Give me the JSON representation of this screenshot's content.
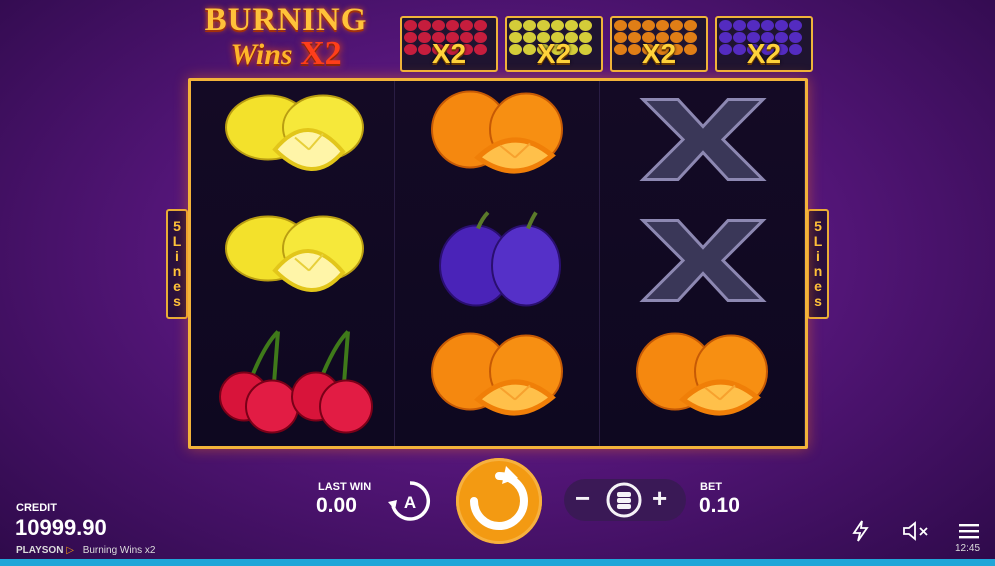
{
  "game": {
    "title_line1": "BURNING",
    "title_line2": "Wins",
    "title_x2": "X2"
  },
  "multipliers": [
    {
      "label": "X2",
      "fruit": "cherry-icon",
      "color": "#d91f3f"
    },
    {
      "label": "X2",
      "fruit": "lemon-icon",
      "color": "#e8e23a"
    },
    {
      "label": "X2",
      "fruit": "orange-icon",
      "color": "#f58a14"
    },
    {
      "label": "X2",
      "fruit": "plum-icon",
      "color": "#5a2ed0"
    }
  ],
  "paylines": {
    "number": "5",
    "letters": [
      "L",
      "i",
      "n",
      "e",
      "s"
    ]
  },
  "reels": [
    [
      "lemon-icon",
      "lemon-icon",
      "cherry-icon"
    ],
    [
      "orange-icon",
      "plum-icon",
      "orange-icon"
    ],
    [
      "x-symbol-icon",
      "x-symbol-icon",
      "orange-icon"
    ]
  ],
  "controls": {
    "last_win_label": "LAST WIN",
    "last_win": "0.00",
    "bet_label": "BET",
    "bet": "0.10",
    "minus": "−",
    "plus": "+"
  },
  "credit": {
    "label": "CREDIT",
    "value": "10999.90"
  },
  "footer": {
    "brand": "PLAYSON",
    "game_name": "Burning Wins x2"
  },
  "clock": "12:45",
  "colors": {
    "accent": "#f39a12",
    "frame": "#f3b33a",
    "bar": "#20a6d8"
  }
}
